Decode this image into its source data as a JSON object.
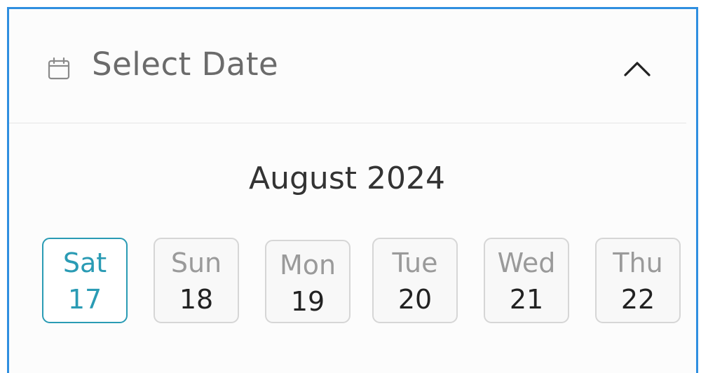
{
  "colors": {
    "frame_border": "#2f8fe0",
    "selected_accent": "#2a9bb4",
    "header_text": "#6b6b6b"
  },
  "header": {
    "icon": "calendar-icon",
    "title": "Select Date",
    "toggle_icon": "chevron-up-icon"
  },
  "calendar": {
    "month_label": "August 2024",
    "selected_index": 0,
    "days": [
      {
        "name": "Sat",
        "number": "17"
      },
      {
        "name": "Sun",
        "number": "18"
      },
      {
        "name": "Mon",
        "number": "19"
      },
      {
        "name": "Tue",
        "number": "20"
      },
      {
        "name": "Wed",
        "number": "21"
      },
      {
        "name": "Thu",
        "number": "22"
      }
    ]
  }
}
